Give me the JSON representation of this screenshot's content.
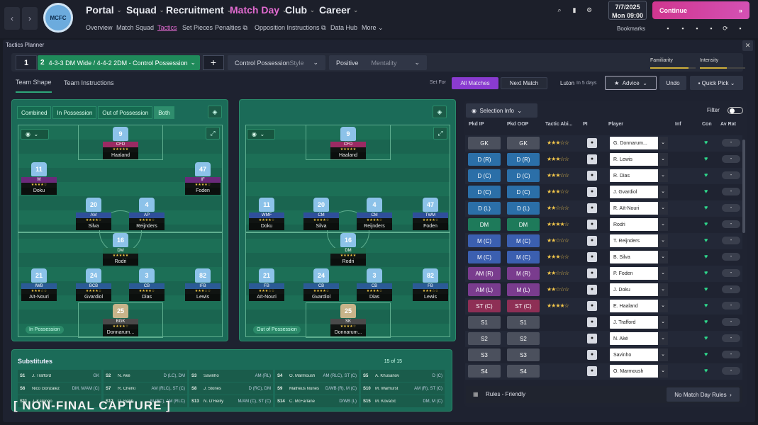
{
  "nav": {
    "back": "‹",
    "forward": "›",
    "club_crest": "MCFC",
    "menus": [
      "Portal",
      "Squad",
      "Recruitment",
      "Match Day",
      "Club",
      "Career"
    ],
    "active_menu": "Match Day",
    "submenus": [
      "Overview",
      "Match Squad",
      "Tactics",
      "Set Pieces",
      "Penalties",
      "Opposition Instructions",
      "Data Hub",
      "More"
    ],
    "active_submenu": "Tactics",
    "date": "7/7/2025",
    "day_time": "Mon  09:00",
    "continue": "Continue",
    "bookmarks": "Bookmarks"
  },
  "tactics_planner": {
    "title": "Tactics Planner",
    "close": "✕",
    "tactic_1": "1",
    "tactic_2": "2",
    "tactic_name": "4-3-3 DM Wide / 4-4-2 2DM - Control Possession",
    "add": "+",
    "style_value": "Control Possession",
    "style_label": "Style",
    "mentality_value": "Positive",
    "mentality_label": "Mentality",
    "familiarity": "Familiarity",
    "intensity": "Intensity",
    "familiarity_level": 0.85,
    "intensity_level": 0.6,
    "tab_team_shape": "Team Shape",
    "tab_team_instructions": "Team Instructions",
    "set_for": "Set For",
    "all_matches": "All Matches",
    "next_match": "Next Match",
    "opponent": "Luton",
    "opponent_when": "In 5 days",
    "advice": "Advice",
    "undo": "Undo",
    "quick_pick": "Quick Pick"
  },
  "pitch": {
    "modes": [
      "Combined",
      "In Possession",
      "Out of Possession",
      "Both"
    ],
    "active_mode": "Both",
    "in_possession": "In Possession",
    "out_of_possession": "Out of Possession",
    "left_players": [
      {
        "num": "9",
        "role": "CFD",
        "name": "Haaland",
        "stars": "★★★★★"
      },
      {
        "num": "11",
        "role": "W",
        "name": "Doku",
        "stars": "★★★★☆"
      },
      {
        "num": "47",
        "role": "IF",
        "name": "Foden",
        "stars": "★★★★☆"
      },
      {
        "num": "20",
        "role": "AM",
        "name": "Silva",
        "stars": "★★★★☆"
      },
      {
        "num": "4",
        "role": "AP",
        "name": "Reijnders",
        "stars": "★★★★☆"
      },
      {
        "num": "16",
        "role": "DM",
        "name": "Rodri",
        "stars": "★★★★★"
      },
      {
        "num": "21",
        "role": "IWB",
        "name": "Aït-Nouri",
        "stars": "★★★☆☆"
      },
      {
        "num": "24",
        "role": "BCB",
        "name": "Gvardiol",
        "stars": "★★★★☆"
      },
      {
        "num": "3",
        "role": "CB",
        "name": "Dias",
        "stars": "★★★★☆"
      },
      {
        "num": "82",
        "role": "IFB",
        "name": "Lewis",
        "stars": "★★★☆☆"
      },
      {
        "num": "25",
        "role": "BGK",
        "name": "Donnarum...",
        "stars": "★★★★☆"
      }
    ],
    "right_players": [
      {
        "num": "9",
        "role": "CFD",
        "name": "Haaland",
        "stars": "★★★★★"
      },
      {
        "num": "11",
        "role": "WMF",
        "name": "Doku",
        "stars": "★★★★☆"
      },
      {
        "num": "20",
        "role": "CM",
        "name": "Silva",
        "stars": "★★★★☆"
      },
      {
        "num": "4",
        "role": "CM",
        "name": "Reijnders",
        "stars": "★★★★☆"
      },
      {
        "num": "47",
        "role": "TWM",
        "name": "Foden",
        "stars": "★★★★☆"
      },
      {
        "num": "16",
        "role": "DM",
        "name": "Rodri",
        "stars": "★★★★★"
      },
      {
        "num": "21",
        "role": "FB",
        "name": "Aït-Nouri",
        "stars": "★★★☆☆"
      },
      {
        "num": "24",
        "role": "CB",
        "name": "Gvardiol",
        "stars": "★★★★☆"
      },
      {
        "num": "3",
        "role": "CB",
        "name": "Dias",
        "stars": "★★★★☆"
      },
      {
        "num": "82",
        "role": "FB",
        "name": "Lewis",
        "stars": "★★★☆☆"
      },
      {
        "num": "25",
        "role": "SK",
        "name": "Donnarum...",
        "stars": "★★★★☆"
      }
    ]
  },
  "substitutes": {
    "title": "Substitutes",
    "count": "15 of 15",
    "items": [
      {
        "s": "S1",
        "name": "J. Trafford",
        "pos": "GK"
      },
      {
        "s": "S2",
        "name": "N. Aké",
        "pos": "D (LC), DM"
      },
      {
        "s": "S3",
        "name": "Savinho",
        "pos": "AM (RL)"
      },
      {
        "s": "S4",
        "name": "O. Marmoush",
        "pos": "AM (RLC), ST (C)"
      },
      {
        "s": "S5",
        "name": "A. Khusanov",
        "pos": "D (C)"
      },
      {
        "s": "S6",
        "name": "Nico González",
        "pos": "DM, M/AM (C)"
      },
      {
        "s": "S7",
        "name": "R. Cherki",
        "pos": "AM (RLC), ST (C)"
      },
      {
        "s": "S8",
        "name": "J. Stones",
        "pos": "D (RC), DM"
      },
      {
        "s": "S9",
        "name": "Matheus Nunes",
        "pos": "D/WB (R), M (C)"
      },
      {
        "s": "S10",
        "name": "M. Warhurst",
        "pos": "AM (R), ST (C)"
      },
      {
        "s": "S11",
        "name": "J. Katongo",
        "pos": ""
      },
      {
        "s": "S12",
        "name": "O. Bobb",
        "pos": "M (RC), AM (RLC)"
      },
      {
        "s": "S13",
        "name": "N. O'Reilly",
        "pos": "M/AM (C), ST (C)"
      },
      {
        "s": "S14",
        "name": "C. McFarlane",
        "pos": "D/WB (L)"
      },
      {
        "s": "S15",
        "name": "M. Kovačić",
        "pos": "DM, M (C)"
      }
    ]
  },
  "selection": {
    "selection_info": "Selection Info",
    "filter": "Filter",
    "headers": [
      "Pkd IP",
      "Pkd OOP",
      "Tactic Abi...",
      "PI",
      "Player",
      "Inf",
      "Con",
      "Av Rat"
    ],
    "rows": [
      {
        "ip": "GK",
        "oop": "GK",
        "stars": "★★★☆☆",
        "player": "G. Donnarum...",
        "avr": "-",
        "color": "#4b505d"
      },
      {
        "ip": "D (R)",
        "oop": "D (R)",
        "stars": "★★★☆☆",
        "player": "R. Lewis",
        "avr": "-",
        "color": "#2b6fa8"
      },
      {
        "ip": "D (C)",
        "oop": "D (C)",
        "stars": "★★★☆☆",
        "player": "R. Dias",
        "avr": "-",
        "color": "#2b6fa8"
      },
      {
        "ip": "D (C)",
        "oop": "D (C)",
        "stars": "★★★☆☆",
        "player": "J. Gvardiol",
        "avr": "-",
        "color": "#2b6fa8"
      },
      {
        "ip": "D (L)",
        "oop": "D (L)",
        "stars": "★★☆☆☆",
        "player": "R. Aït-Nouri",
        "avr": "-",
        "color": "#2b6fa8"
      },
      {
        "ip": "DM",
        "oop": "DM",
        "stars": "★★★★☆",
        "player": "Rodri",
        "avr": "-",
        "color": "#1e7a5a"
      },
      {
        "ip": "M (C)",
        "oop": "M (C)",
        "stars": "★★☆☆☆",
        "player": "T. Reijnders",
        "avr": "-",
        "color": "#3b5fb0"
      },
      {
        "ip": "M (C)",
        "oop": "M (C)",
        "stars": "★★★☆☆",
        "player": "B. Silva",
        "avr": "-",
        "color": "#3b5fb0"
      },
      {
        "ip": "AM (R)",
        "oop": "M (R)",
        "stars": "★★☆☆☆",
        "player": "P. Foden",
        "avr": "-",
        "color": "#7a3c8e"
      },
      {
        "ip": "AM (L)",
        "oop": "M (L)",
        "stars": "★★☆☆☆",
        "player": "J. Doku",
        "avr": "-",
        "color": "#7a3c8e"
      },
      {
        "ip": "ST (C)",
        "oop": "ST (C)",
        "stars": "★★★★☆",
        "player": "E. Haaland",
        "avr": "-",
        "color": "#8e2f55"
      },
      {
        "ip": "S1",
        "oop": "S1",
        "stars": "",
        "player": "J. Trafford",
        "avr": "-",
        "color": "#4b505d"
      },
      {
        "ip": "S2",
        "oop": "S2",
        "stars": "",
        "player": "N. Aké",
        "avr": "-",
        "color": "#4b505d"
      },
      {
        "ip": "S3",
        "oop": "S3",
        "stars": "",
        "player": "Savinho",
        "avr": "-",
        "color": "#4b505d"
      },
      {
        "ip": "S4",
        "oop": "S4",
        "stars": "",
        "player": "O. Marmoush",
        "avr": "-",
        "color": "#4b505d"
      }
    ],
    "rules": "Rules - Friendly",
    "no_rules": "No Match Day Rules"
  },
  "watermark": "[ NON-FINAL CAPTURE ]"
}
